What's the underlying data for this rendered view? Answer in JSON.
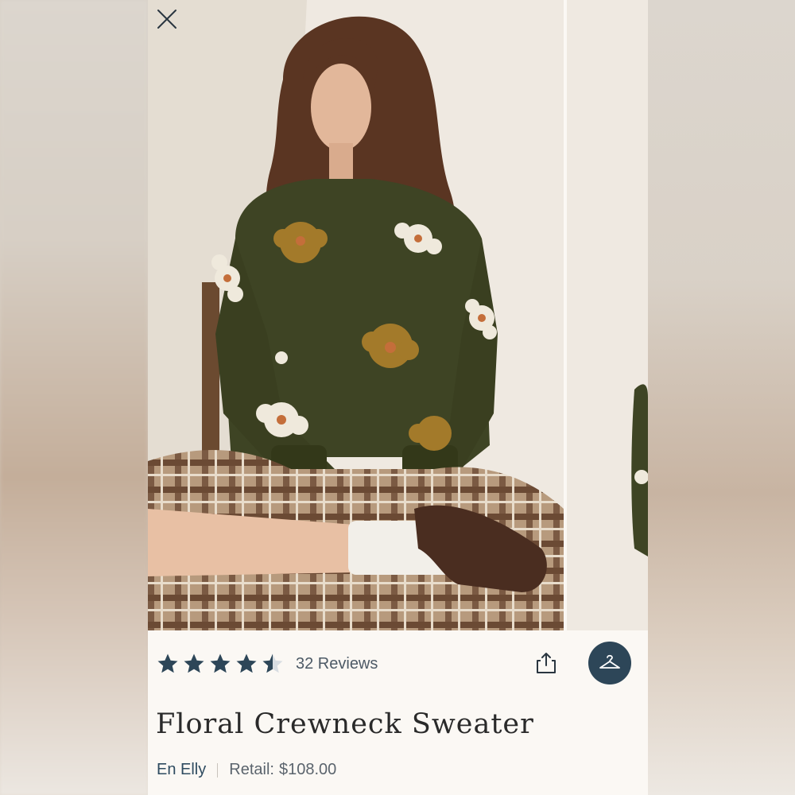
{
  "product": {
    "rating": 4.5,
    "reviews_label": "32 Reviews",
    "title": "Floral Crewneck Sweater",
    "brand": "En Elly",
    "retail_label": "Retail:",
    "retail_price": "$108.00"
  },
  "colors": {
    "accent": "#2d4658",
    "star": "#2d4658",
    "brand_link": "#2e4b60",
    "sweater": "#3e4424"
  },
  "icons": {
    "close": "close-icon",
    "share": "share-icon",
    "closet": "hanger-icon"
  }
}
